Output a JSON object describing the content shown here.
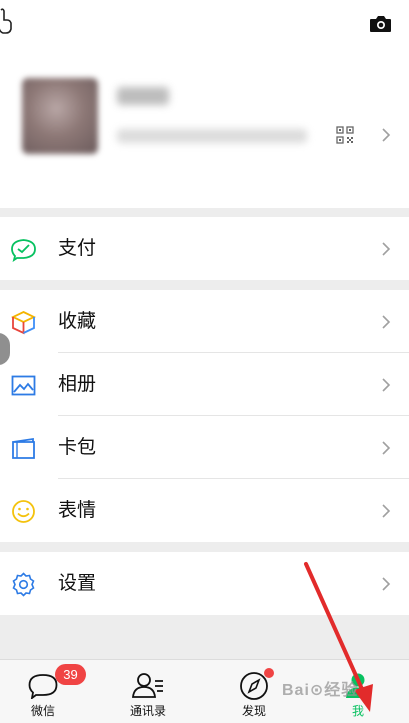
{
  "profile": {
    "name": "",
    "wechat_id": ""
  },
  "menu": {
    "pay": "支付",
    "favorites": "收藏",
    "album": "相册",
    "cards": "卡包",
    "stickers": "表情",
    "settings": "设置"
  },
  "tabbar": {
    "chats": {
      "label": "微信",
      "badge": "39"
    },
    "contacts": {
      "label": "通讯录"
    },
    "discover": {
      "label": "发现"
    },
    "me": {
      "label": "我"
    }
  },
  "colors": {
    "accent": "#07c160",
    "badge": "#f04444",
    "arrow": "#e22b2b"
  },
  "icons": [
    "hand-pointer-icon",
    "camera-icon",
    "qr-code-icon",
    "chevron-right-icon",
    "pay-icon",
    "favorites-icon",
    "album-icon",
    "cards-icon",
    "stickers-icon",
    "settings-gear-icon",
    "chats-icon",
    "contacts-icon",
    "discover-compass-icon",
    "me-icon"
  ]
}
